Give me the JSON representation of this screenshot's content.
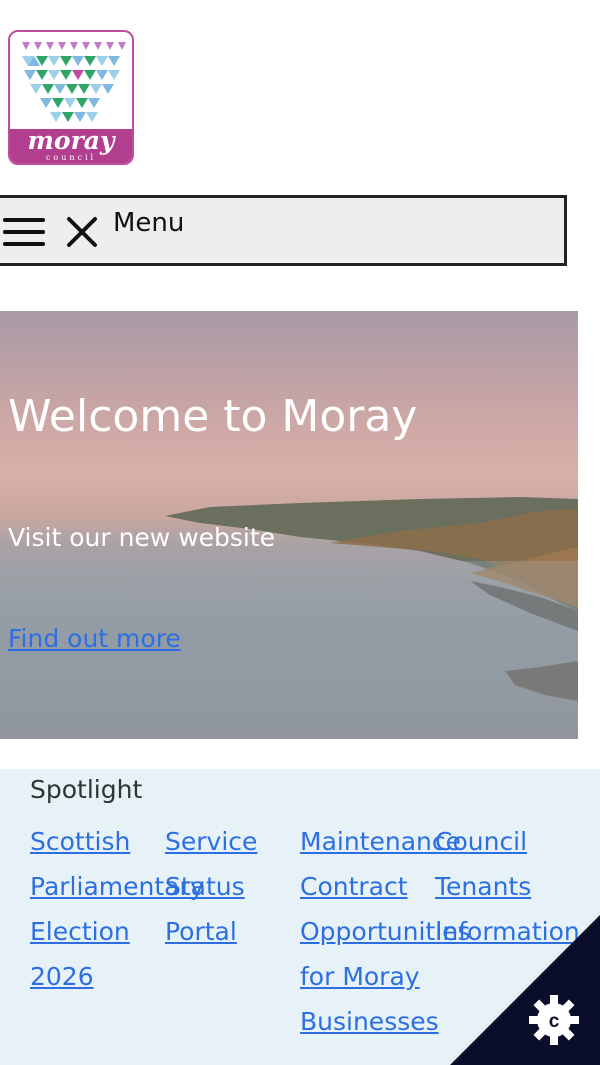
{
  "logo": {
    "word": "moray",
    "subword": "council"
  },
  "menu": {
    "label": "Menu"
  },
  "hero": {
    "title": "Welcome to Moray",
    "subtitle": "Visit our new website",
    "link": "Find out more"
  },
  "spotlight": {
    "heading": "Spotlight",
    "items": [
      {
        "label": "Scottish Parliamentary Election 2026"
      },
      {
        "label": "Service Status Portal"
      },
      {
        "label": "Maintenance Contract Opportunities for Moray Businesses"
      },
      {
        "label": "Council Tenants Information"
      }
    ]
  },
  "colors": {
    "link": "#2d6fe0",
    "spotlight_bg": "#e6f2f8",
    "logo_accent": "#b23e8f",
    "cookie_bg": "#0b0e2a"
  },
  "icons": [
    "hamburger-icon",
    "close-icon",
    "cookie-settings-icon"
  ]
}
